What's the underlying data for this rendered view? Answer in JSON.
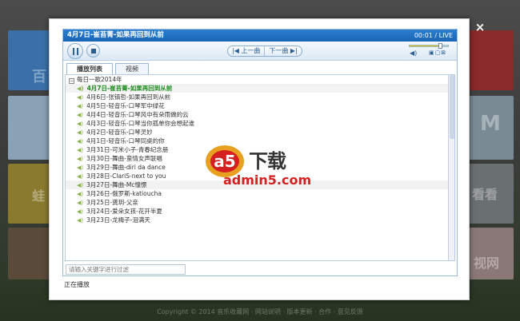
{
  "background": {
    "tiles": [
      "百",
      "蛙",
      "M",
      "看看",
      "视网"
    ],
    "footer": "Copyright © 2014 音乐收藏网 · 网站说明 · 版本更新 · 合作 · 意见反馈"
  },
  "close_label": "×",
  "player": {
    "title": "4月7日-崔苔菁-如果再回到从前",
    "time": "00:01 / LIVE",
    "prev_label": "上一曲",
    "next_label": "下一曲",
    "volume": 0.82
  },
  "tabs": [
    {
      "label": "播放列表",
      "active": true
    },
    {
      "label": "视频",
      "active": false
    }
  ],
  "playlist": {
    "group_label": "每日一歌2014年",
    "items": [
      {
        "text": "4月7日-崔苔菁-如果再回到从前",
        "playing": true
      },
      {
        "text": "4月6日-张镐哲-如果再回到从前"
      },
      {
        "text": "4月5日-轻音乐-口琴军中绿花"
      },
      {
        "text": "4月4日-轻音乐-口琴风中有朵雨做的云"
      },
      {
        "text": "4月3日-轻音乐-口琴当你孤单你会想起谁"
      },
      {
        "text": "4月2日-轻音乐-口琴灵妙"
      },
      {
        "text": "4月1日-轻音乐-口琴同桌的你"
      },
      {
        "text": "3月31日-可米小子-青春纪念册"
      },
      {
        "text": "3月30日-舞曲-蛮情女声联唱"
      },
      {
        "text": "3月29日-舞曲-diri da dance"
      },
      {
        "text": "3月28日-ClariS-next to you"
      },
      {
        "text": "3月27日-舞曲-Mc憧憬"
      },
      {
        "text": "3月26日-俄罗斯-katioucha"
      },
      {
        "text": "3月25日-龚玥-父亲"
      },
      {
        "text": "3月24日-爱朵女孩-花开半夏"
      },
      {
        "text": "3月23日-龙梅子-泪满天"
      }
    ]
  },
  "search_placeholder": "请输入关键字进行过滤",
  "status": "正在播放",
  "watermark": {
    "cn": "下载",
    "en": "admin5.com",
    "logo_text": "a5"
  }
}
